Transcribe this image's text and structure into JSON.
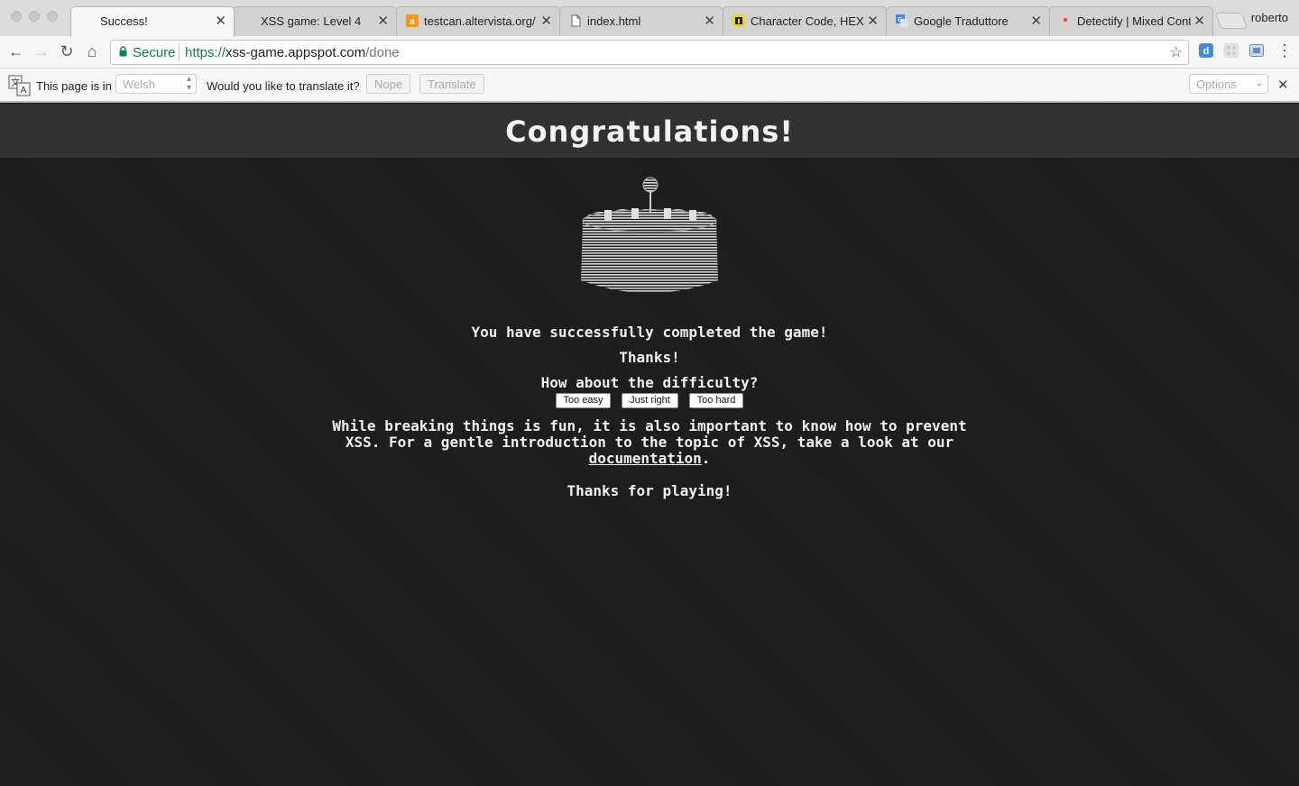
{
  "tabs": [
    {
      "title": "Success!",
      "favicon": "none",
      "active": true
    },
    {
      "title": "XSS game: Level 4",
      "favicon": "none",
      "active": false
    },
    {
      "title": "testcan.altervista.org/",
      "favicon": "altervista-icon",
      "active": false
    },
    {
      "title": "index.html",
      "favicon": "document-icon",
      "active": false
    },
    {
      "title": "Character Code, HEX, ",
      "favicon": "info-icon",
      "active": false
    },
    {
      "title": "Google Traduttore",
      "favicon": "google-translate-icon",
      "active": false
    },
    {
      "title": "Detectify | Mixed Cont",
      "favicon": "detectify-icon",
      "active": false
    }
  ],
  "profile": {
    "name": "roberto"
  },
  "toolbar": {
    "secure_label": "Secure",
    "url_scheme": "https://",
    "url_host": "xss-game.appspot.com",
    "url_path": "/done"
  },
  "translate_bar": {
    "page_is_in": "This page is in",
    "language": "Welsh",
    "question": "Would you like to translate it?",
    "nope_label": "Nope",
    "translate_label": "Translate",
    "options_label": "Options"
  },
  "page": {
    "title": "Congratulations!",
    "completed": "You have successfully completed the game!",
    "thanks": "Thanks!",
    "difficulty_question": "How about the difficulty?",
    "rating_buttons": [
      "Too easy",
      "Just right",
      "Too hard"
    ],
    "para_line1": "While breaking things is fun, it is also important to know how to prevent",
    "para_line2": "XSS. For a gentle introduction to the topic of XSS, take a look at our",
    "doc_link": "documentation",
    "para_end": ".",
    "thanks_playing": "Thanks for playing!"
  },
  "colors": {
    "secure_green": "#0b8043",
    "page_background": "#1c1c1c",
    "header_band": "#2f2f2f"
  }
}
